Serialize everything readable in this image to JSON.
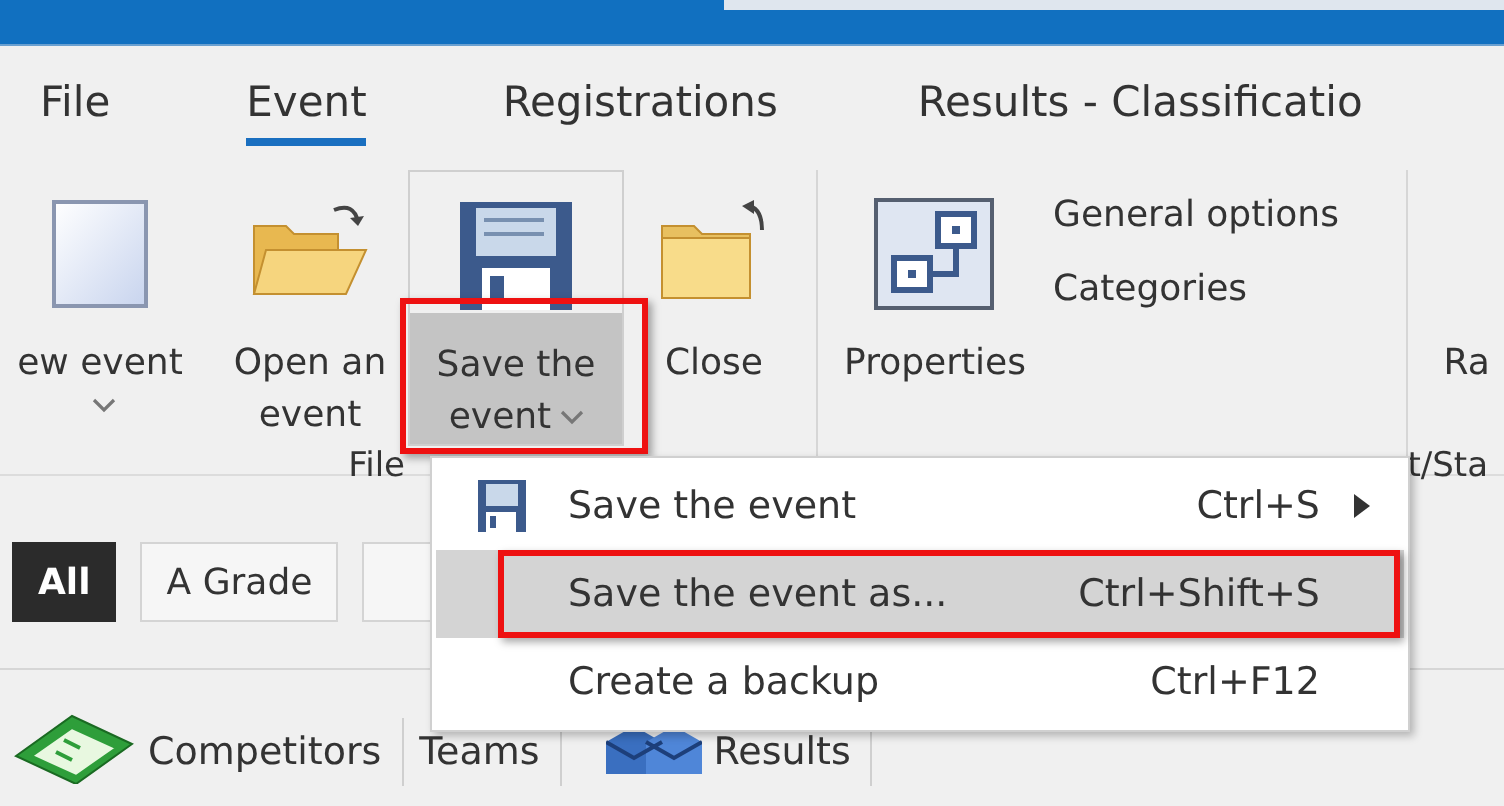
{
  "menu_tabs": [
    {
      "label": "File",
      "selected": false
    },
    {
      "label": "Event",
      "selected": true
    },
    {
      "label": "Registrations",
      "selected": false
    },
    {
      "label": "Results - Classificatio",
      "selected": false
    }
  ],
  "ribbon": {
    "groups": [
      {
        "label": "File",
        "buttons": [
          {
            "kind": "new",
            "label": "ew event",
            "dropdown": true,
            "pressed": false,
            "framed": false
          },
          {
            "kind": "open",
            "label": "Open an\nevent",
            "dropdown": false,
            "pressed": false,
            "framed": false
          },
          {
            "kind": "save",
            "label": "Save the\nevent",
            "dropdown": true,
            "pressed": true,
            "framed": true
          },
          {
            "kind": "close",
            "label": "Close",
            "dropdown": false,
            "pressed": false,
            "framed": false
          }
        ]
      },
      {
        "buttons": [
          {
            "kind": "properties",
            "label": "Properties",
            "dropdown": false,
            "pressed": false,
            "framed": false
          }
        ],
        "small_items": [
          "General options",
          "Categories"
        ]
      },
      {
        "label": "t/Sta",
        "buttons": [
          {
            "kind": "text",
            "label": "Ra",
            "dropdown": false,
            "pressed": false,
            "framed": false
          }
        ]
      }
    ]
  },
  "filters": [
    {
      "label": "All",
      "selected": true
    },
    {
      "label": "A Grade",
      "selected": false
    },
    {
      "selected": false
    }
  ],
  "bottom_tabs": [
    {
      "kind": "competitors",
      "label": "Competitors"
    },
    {
      "kind": "teams",
      "label": "Teams"
    },
    {
      "kind": "results",
      "label": "Results"
    }
  ],
  "dropdown_menu": {
    "items": [
      {
        "kind": "save",
        "label": "Save the event",
        "shortcut": "Ctrl+S",
        "submenu": true,
        "highlighted": false,
        "framed": false
      },
      {
        "kind": "none",
        "label": "Save the event as...",
        "shortcut": "Ctrl+Shift+S",
        "submenu": false,
        "highlighted": true,
        "framed": true
      },
      {
        "kind": "none",
        "label": "Create a backup",
        "shortcut": "Ctrl+F12",
        "submenu": false,
        "highlighted": false,
        "framed": false
      }
    ]
  }
}
